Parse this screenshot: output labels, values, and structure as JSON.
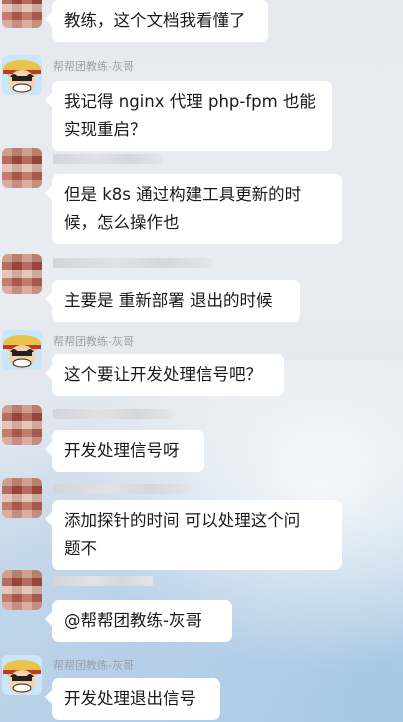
{
  "messages": [
    {
      "sender_name": "",
      "avatar": "blurred",
      "lines": [
        "教练，这个文档我看懂了"
      ]
    },
    {
      "sender_name": "帮帮团教练-灰哥",
      "avatar": "luffy",
      "lines": [
        "我记得 nginx 代理 php-fpm 也能",
        "实现重启？"
      ]
    },
    {
      "sender_name": "",
      "avatar": "blurred",
      "lines": [
        "但是 k8s 通过构建工具更新的时",
        "候，怎么操作也"
      ]
    },
    {
      "sender_name": "",
      "avatar": "blurred",
      "lines": [
        "主要是 重新部署 退出的时候"
      ]
    },
    {
      "sender_name": "帮帮团教练-灰哥",
      "avatar": "luffy",
      "lines": [
        "这个要让开发处理信号吧？"
      ]
    },
    {
      "sender_name": "",
      "avatar": "blurred",
      "lines": [
        "开发处理信号呀"
      ]
    },
    {
      "sender_name": "",
      "avatar": "blurred",
      "lines": [
        "添加探针的时间 可以处理这个问",
        "题不"
      ]
    },
    {
      "sender_name": "",
      "avatar": "blurred",
      "lines": [
        "@帮帮团教练-灰哥"
      ]
    },
    {
      "sender_name": "帮帮团教练-灰哥",
      "avatar": "luffy",
      "lines": [
        "开发处理退出信号"
      ]
    }
  ],
  "colors": {
    "bubble": "#ffffff",
    "name_text": "#9aa0a8",
    "message_text": "#191919"
  }
}
